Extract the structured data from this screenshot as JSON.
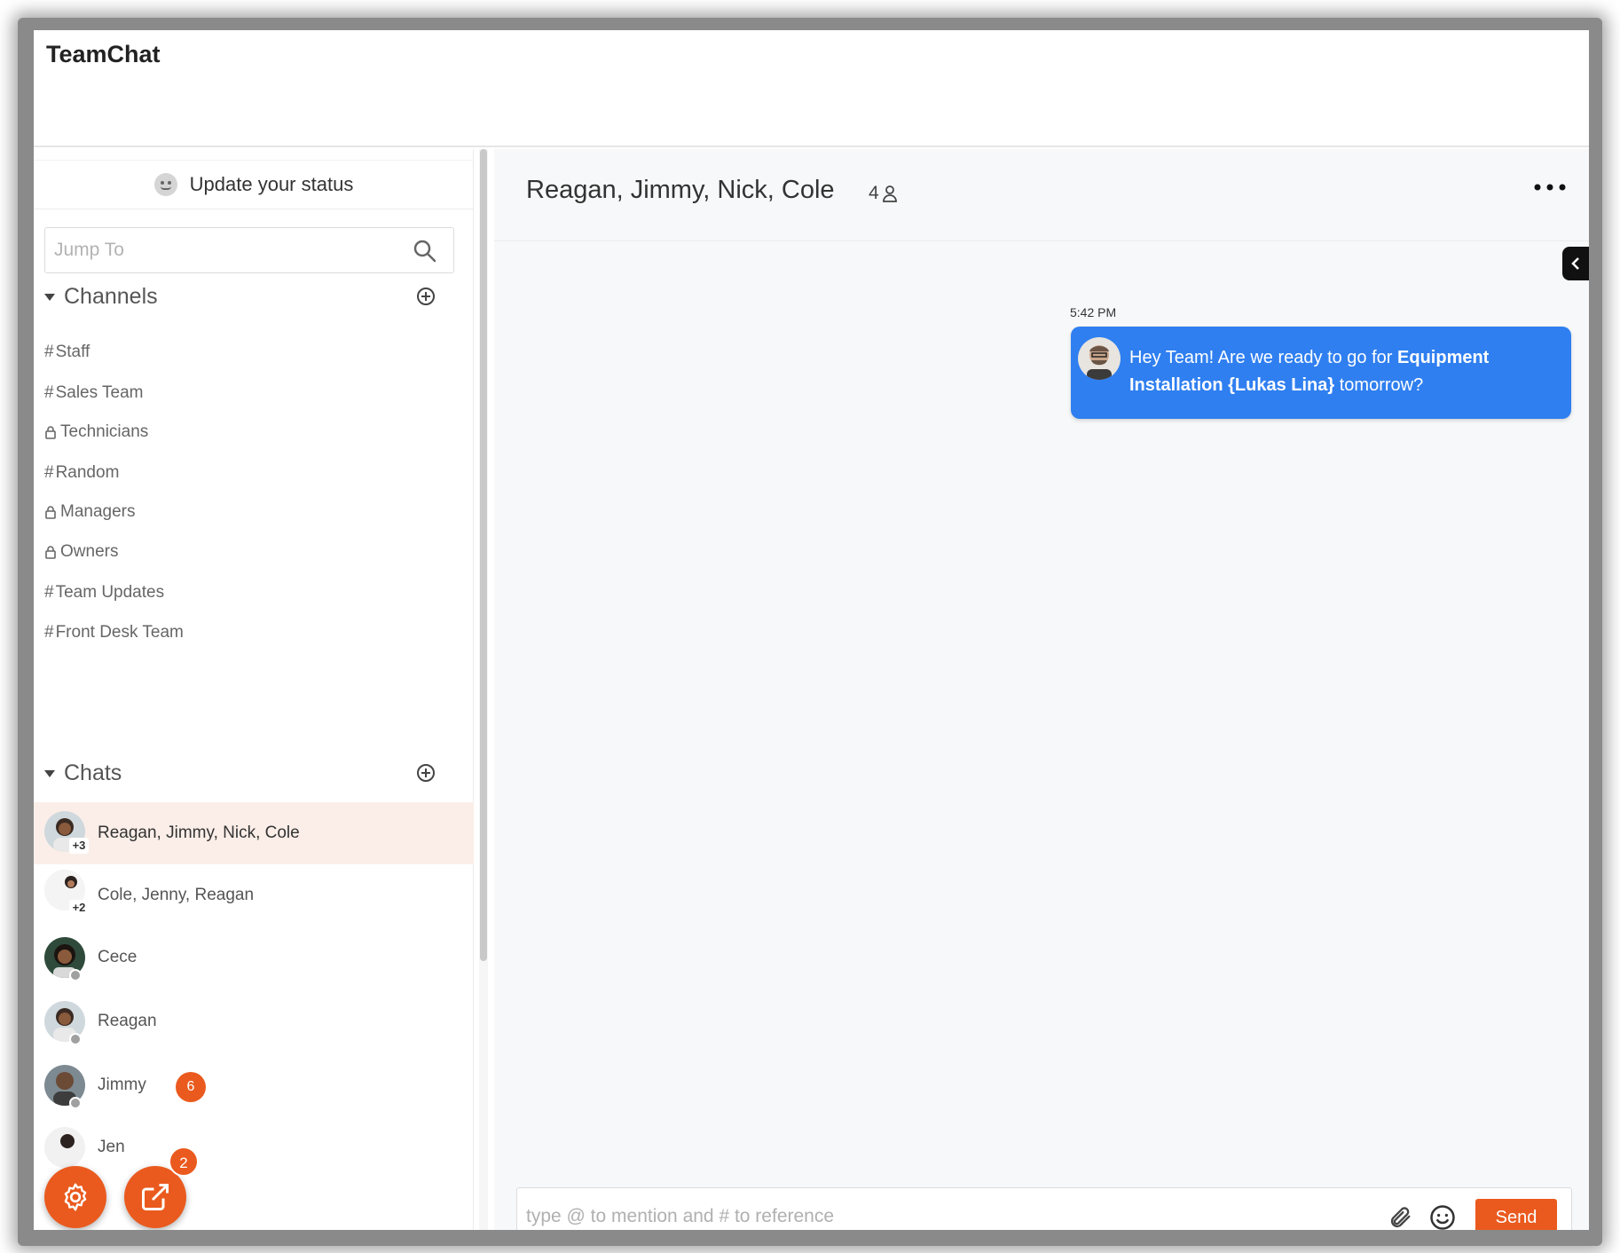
{
  "app": {
    "title": "TeamChat"
  },
  "sidebar": {
    "status_label": "Update your status",
    "search": {
      "placeholder": "Jump To"
    },
    "channels_header": "Channels",
    "channels": [
      {
        "prefix": "#",
        "label": "Staff",
        "locked": false
      },
      {
        "prefix": "#",
        "label": "Sales Team",
        "locked": false
      },
      {
        "prefix": "",
        "label": "Technicians",
        "locked": true
      },
      {
        "prefix": "#",
        "label": "Random",
        "locked": false
      },
      {
        "prefix": "",
        "label": "Managers",
        "locked": true
      },
      {
        "prefix": "",
        "label": "Owners",
        "locked": true
      },
      {
        "prefix": "#",
        "label": "Team Updates",
        "locked": false
      },
      {
        "prefix": "#",
        "label": "Front Desk Team",
        "locked": false
      }
    ],
    "chats_header": "Chats",
    "chats": [
      {
        "name": "Reagan, Jimmy, Nick, Cole",
        "extra": "+3",
        "active": true
      },
      {
        "name": "Cole, Jenny, Reagan",
        "extra": "+2",
        "active": false
      },
      {
        "name": "Cece",
        "active": false
      },
      {
        "name": "Reagan",
        "active": false
      },
      {
        "name": "Jimmy",
        "unread": "6",
        "active": false
      },
      {
        "name": "Jen",
        "unread": "2",
        "active": false
      }
    ],
    "fab_settings_icon": "gear-icon",
    "fab_compose_icon": "external-link-icon"
  },
  "conversation": {
    "title": "Reagan, Jimmy, Nick, Cole",
    "member_count": "4",
    "messages": [
      {
        "time": "5:42 PM",
        "text_before": "Hey Team! Are we ready to go for ",
        "text_bold": "Equipment Installation {Lukas Lina}",
        "text_after": " tomorrow?"
      }
    ],
    "composer": {
      "placeholder": "type @ to mention and # to reference",
      "send_label": "Send"
    }
  },
  "colors": {
    "accent": "#ea5a1e",
    "message_bubble": "#2f7ff0",
    "active_chat_bg": "#fbeee8"
  }
}
